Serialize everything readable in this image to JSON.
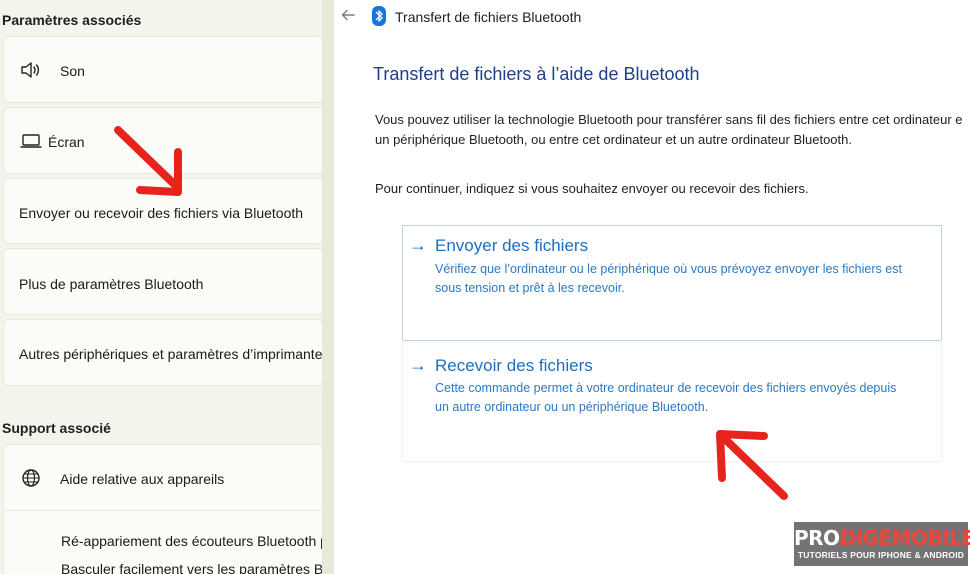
{
  "left": {
    "related_settings_title": "Paramètres associés",
    "items": [
      {
        "label": "Son",
        "icon": "speaker-icon"
      },
      {
        "label": "Écran",
        "icon": "monitor-icon"
      },
      {
        "label": "Envoyer ou recevoir des fichiers via Bluetooth"
      },
      {
        "label": "Plus de paramètres Bluetooth"
      },
      {
        "label": "Autres périphériques et paramètres d’imprimante"
      }
    ],
    "support_title": "Support associé",
    "support": {
      "label": "Aide relative aux appareils",
      "icon": "globe-icon",
      "links": [
        "Ré-appariement des écouteurs Bluetooth p",
        "Basculer facilement vers les paramètres Blu"
      ]
    }
  },
  "right": {
    "window_title": "Transfert de fichiers Bluetooth",
    "heading": "Transfert de fichiers à l’aide de Bluetooth",
    "intro_line1": "Vous pouvez utiliser la technologie Bluetooth pour transférer sans fil des fichiers entre cet ordinateur e",
    "intro_line2": "un périphérique Bluetooth, ou entre cet ordinateur et un autre ordinateur Bluetooth.",
    "continue_text": "Pour continuer, indiquez si vous souhaitez envoyer ou recevoir des fichiers.",
    "send": {
      "title": "Envoyer des fichiers",
      "desc_line1": "Vérifiez que l’ordinateur ou le périphérique où vous prévoyez envoyer les fichiers est",
      "desc_line2": "sous tension et prêt à les recevoir."
    },
    "receive": {
      "title": "Recevoir des fichiers",
      "desc_line1": "Cette commande permet à votre ordinateur de recevoir des fichiers envoyés depuis",
      "desc_line2": "un autre ordinateur ou un périphérique Bluetooth."
    }
  },
  "watermark": {
    "brand_pre": "PRO",
    "brand_hl": "DIGEMOBILE",
    "tagline": "TUTORIELS POUR IPHONE & ANDROID"
  },
  "colors": {
    "accent_link": "#1c6fc1",
    "heading": "#1e3f8a",
    "annotation_arrow": "#e8231b"
  }
}
